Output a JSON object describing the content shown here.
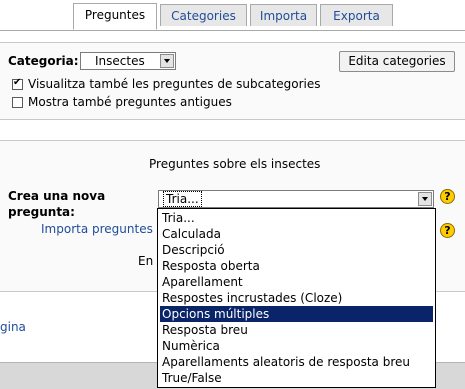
{
  "tabs": [
    {
      "label": "Preguntes",
      "active": true
    },
    {
      "label": "Categories",
      "active": false
    },
    {
      "label": "Importa",
      "active": false
    },
    {
      "label": "Exporta",
      "active": false
    }
  ],
  "category": {
    "label": "Categoria:",
    "selected": "Insectes",
    "edit_button": "Edita categories",
    "show_subcategories_label": "Visualitza també les preguntes de subcategories",
    "show_subcategories_checked": true,
    "show_old_label": "Mostra també preguntes antigues",
    "show_old_checked": false
  },
  "main": {
    "heading": "Preguntes sobre els insectes",
    "create_label": "Crea una nova pregunta:",
    "create_select_value": "Tria...",
    "import_link": "Importa preguntes d",
    "partial_text": "En",
    "left_link": "gina"
  },
  "dropdown": {
    "items": [
      "Tria...",
      "Calculada",
      "Descripció",
      "Resposta oberta",
      "Aparellament",
      "Respostes incrustades (Cloze)",
      "Opcions múltiples",
      "Resposta breu",
      "Numèrica",
      "Aparellaments aleatoris de resposta breu",
      "True/False"
    ],
    "selected_index": 6
  },
  "colors": {
    "link": "#1f4d9a",
    "selection": "#0a246a",
    "help": "#ffcc00"
  }
}
